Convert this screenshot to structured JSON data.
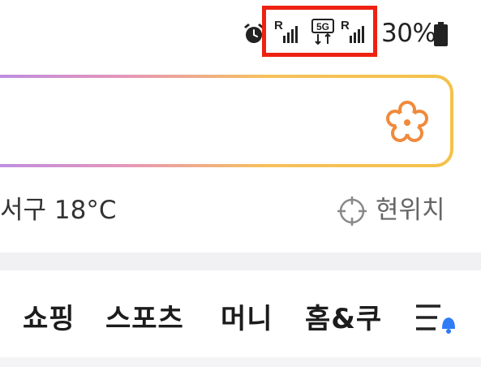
{
  "status_bar": {
    "battery_text": "30%",
    "network_type": "5G",
    "roaming_label": "R",
    "icons": [
      "alarm-icon",
      "signal-roaming-icon",
      "5g-data-icon",
      "signal-roaming-icon",
      "battery-icon"
    ],
    "highlight_color": "#ee2211"
  },
  "search": {
    "gradient_colors": [
      "#b98ce6",
      "#e596b8",
      "#f7c05c",
      "#f4c24a"
    ],
    "icon": "flower-icon",
    "icon_color": "#f08a3c"
  },
  "weather": {
    "text": "서구 18°C"
  },
  "location": {
    "icon": "crosshair-location-icon",
    "label": "현위치"
  },
  "tabs": [
    {
      "label": "쇼핑"
    },
    {
      "label": "스포츠"
    },
    {
      "label": "머니"
    },
    {
      "label": "홈&쿠"
    }
  ],
  "menu": {
    "icon": "menu-bell-icon",
    "badge_color": "#2f7cf6"
  }
}
